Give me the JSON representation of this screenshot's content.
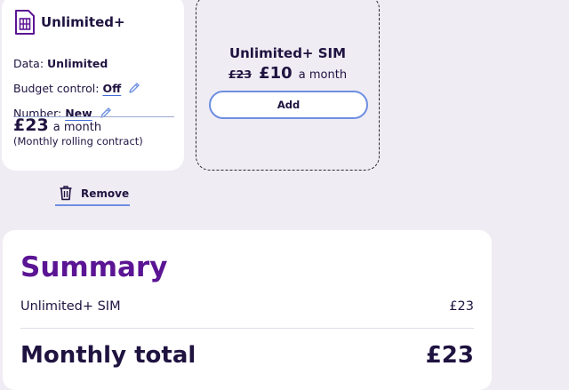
{
  "plan": {
    "name": "Unlimited+",
    "icon": "sim-card-icon",
    "data_label": "Data: ",
    "data_value": "Unlimited",
    "budget_label": "Budget control: ",
    "budget_value": "Off",
    "number_label": "Number: ",
    "number_value": "New",
    "edit_icon": "pencil-icon",
    "price": "£23",
    "price_unit": "a month",
    "contract_note": "(Monthly rolling contract)"
  },
  "remove": {
    "label": "Remove",
    "icon": "trash-icon"
  },
  "offer": {
    "title": "Unlimited+ SIM",
    "old_price": "£23",
    "new_price": "£10",
    "price_unit": "a month",
    "add_label": "Add"
  },
  "summary": {
    "title": "Summary",
    "items": [
      {
        "label": "Unlimited+ SIM",
        "value": "£23"
      }
    ],
    "total_label": "Monthly total",
    "total_value": "£23"
  },
  "colors": {
    "background": "#f0ecf4",
    "accent_purple": "#5b1594",
    "text_navy": "#1f1340",
    "link_blue": "#6d8fe0"
  }
}
